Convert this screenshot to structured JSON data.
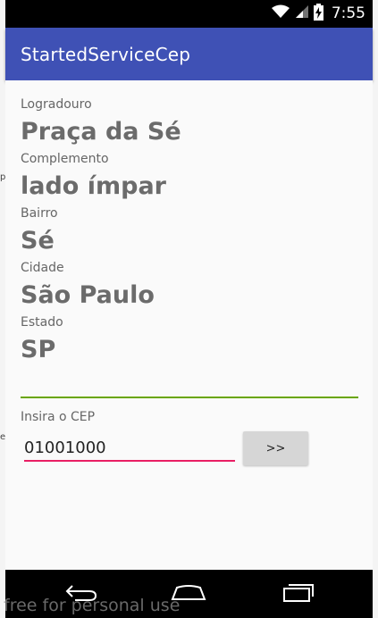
{
  "status_bar": {
    "time": "7:55",
    "icons": [
      "wifi-icon",
      "signal-icon",
      "battery-charging-icon"
    ]
  },
  "app_bar": {
    "title": "StartedServiceCep"
  },
  "address": {
    "fields": [
      {
        "label": "Logradouro",
        "value": "Praça da Sé"
      },
      {
        "label": "Complemento",
        "value": "lado ímpar"
      },
      {
        "label": "Bairro",
        "value": "Sé"
      },
      {
        "label": "Cidade",
        "value": "São Paulo"
      },
      {
        "label": "Estado",
        "value": "SP"
      }
    ]
  },
  "cep": {
    "label": "Insira o CEP",
    "value": "01001000",
    "button_label": ">>"
  },
  "nav_bar": {
    "icons": [
      "back-icon",
      "home-icon",
      "recents-icon"
    ]
  },
  "background_fragments": [
    "p",
    "e"
  ],
  "watermark": "free for personal use",
  "colors": {
    "app_bar": "#3f51b5",
    "divider": "#6aa600",
    "input_underline": "#e91e63",
    "button": "#d6d6d6"
  }
}
